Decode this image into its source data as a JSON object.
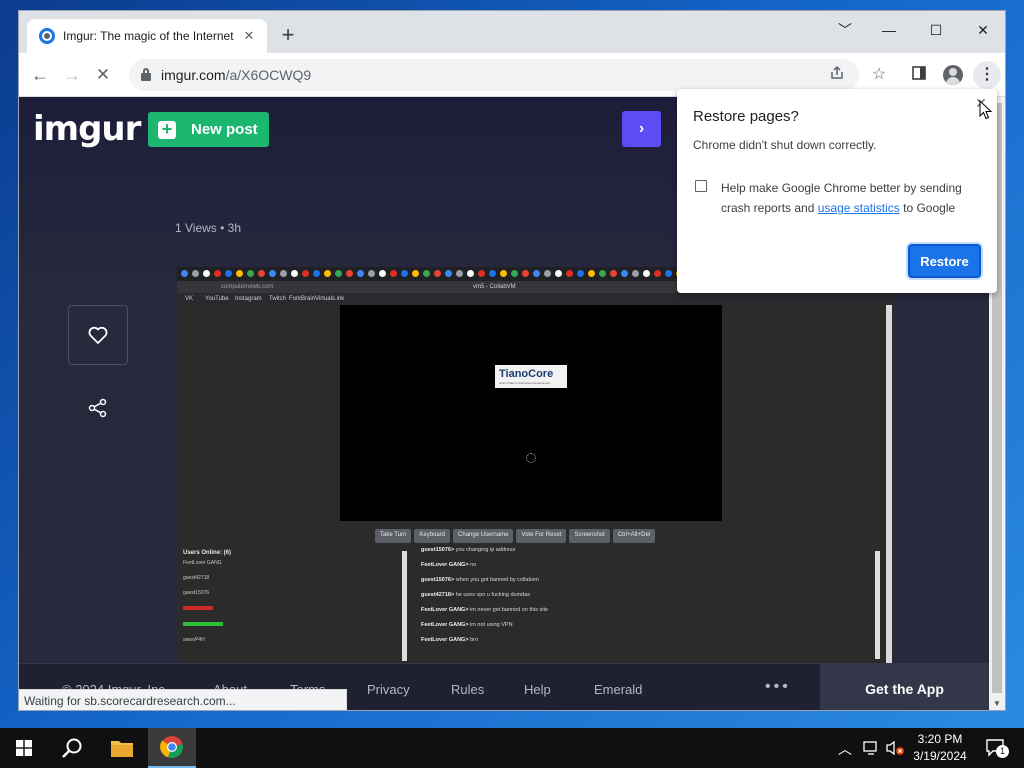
{
  "browser": {
    "tab": {
      "title": "Imgur: The magic of the Internet",
      "close": "✕"
    },
    "newtab": "+",
    "window_controls": {
      "minimize": "﹀",
      "restore": "—",
      "maximize": "☐",
      "close": "✕"
    },
    "nav": {
      "back": "←",
      "forward": "→",
      "reload": "✕"
    },
    "url": {
      "host": "imgur.com",
      "path": "/a/X6OCWQ9"
    },
    "menu": "⋮"
  },
  "imgur": {
    "logo": "imgur",
    "new_post": "New post",
    "next": "›",
    "meta": "1 Views • 3h",
    "footer": {
      "copyright": "© 2024 Imgur, Inc",
      "links": [
        "About",
        "Terms",
        "Privacy",
        "Rules",
        "Help",
        "Emerald"
      ],
      "dots": "•••",
      "get_app": "Get the App"
    }
  },
  "embedded": {
    "address": "computernewb.com",
    "tab_title": "vm5 - CollabVM",
    "bookmarks": [
      "VK",
      "YouTube",
      "Instagram",
      "Twitch",
      "ForkBrainVirtuals.ink"
    ],
    "bios_logo": "TianoCore",
    "bios_sub": "Open Platform Firmware Development",
    "buttons": [
      "Take Turn",
      "Keyboard",
      "Change Username",
      "Vote For Reset",
      "Screenshot",
      "Ctrl+Alt+Del"
    ],
    "users_title": "Users Online: (6)",
    "users": [
      {
        "name": "FeetLover GANG",
        "color": "#c8c8c8"
      },
      {
        "name": "guest42718",
        "color": "#c8c8c8"
      },
      {
        "name": "guest15076",
        "color": "#c8c8c8"
      },
      {
        "name": "",
        "color": "#d12a2a"
      },
      {
        "name": "",
        "color": "#2fbf3a"
      },
      {
        "name": "awooP4H",
        "color": "#c8c8c8"
      }
    ],
    "chat": [
      {
        "user": "guest15076>",
        "text": "you changing ip address"
      },
      {
        "user": "FeetLover GANG>",
        "text": "no"
      },
      {
        "user": "guest15076>",
        "text": "when you got banned by collabvm"
      },
      {
        "user": "guest42718>",
        "text": "he uses vpn u fucking dumdas"
      },
      {
        "user": "FeetLover GANG>",
        "text": "im never get banned on this site"
      },
      {
        "user": "FeetLover GANG>",
        "text": "im not using VPN"
      },
      {
        "user": "FeetLover GANG>",
        "text": "bro"
      }
    ]
  },
  "status_bar": "Waiting for sb.scorecardresearch.com...",
  "dialog": {
    "title": "Restore pages?",
    "message": "Chrome didn't shut down correctly.",
    "checkbox_text_1": "Help make Google Chrome better by sending crash reports and",
    "checkbox_link": "usage statistics",
    "checkbox_text_2": "to Google",
    "restore": "Restore",
    "close": "✕"
  },
  "taskbar": {
    "time": "3:20 PM",
    "date": "3/19/2024",
    "notifications": "1"
  },
  "colors": {
    "imgur_green": "#1bb76e",
    "imgur_purple": "#5b4cf5",
    "chrome_blue": "#1a73e8"
  }
}
